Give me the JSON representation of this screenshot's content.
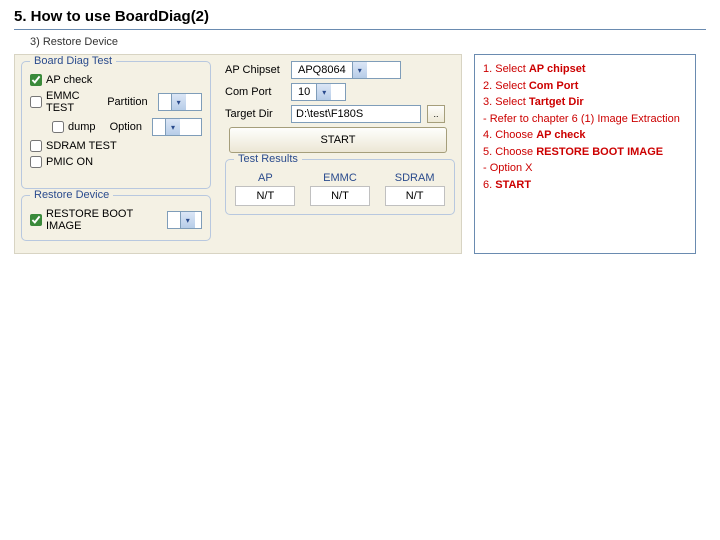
{
  "page": {
    "title": "5. How to use BoardDiag(2)",
    "subtitle": "3) Restore Device"
  },
  "panel": {
    "bdt_legend": "Board Diag Test",
    "ap_check": "AP check",
    "emmc_test": "EMMC TEST",
    "partition_label": "Partition",
    "dump": "dump",
    "option_label": "Option",
    "sdram_test": "SDRAM TEST",
    "pmic_on": "PMIC ON",
    "restore_legend": "Restore Device",
    "restore_boot": "RESTORE BOOT IMAGE",
    "ap_chipset_label": "AP Chipset",
    "ap_chipset_value": "APQ8064",
    "com_port_label": "Com Port",
    "com_port_value": "10",
    "target_dir_label": "Target Dir",
    "target_dir_value": "D:\\test\\F180S",
    "browse": "..",
    "start": "START",
    "results_legend": "Test Results",
    "result_ap": "AP",
    "result_emmc": "EMMC",
    "result_sdram": "SDRAM",
    "nt": "N/T"
  },
  "instructions": {
    "l1a": "1. Select ",
    "l1b": "AP chipset",
    "l2a": "2. Select ",
    "l2b": "Com Port",
    "l3a": "3. Select ",
    "l3b": "Tartget Dir",
    "l4": "- Refer to chapter 6 (1) Image Extraction",
    "l5a": "4. Choose ",
    "l5b": "AP check",
    "l6a": "5. Choose ",
    "l6b": "RESTORE BOOT IMAGE",
    "l7": "- Option X",
    "l8a": "6. ",
    "l8b": "START"
  }
}
